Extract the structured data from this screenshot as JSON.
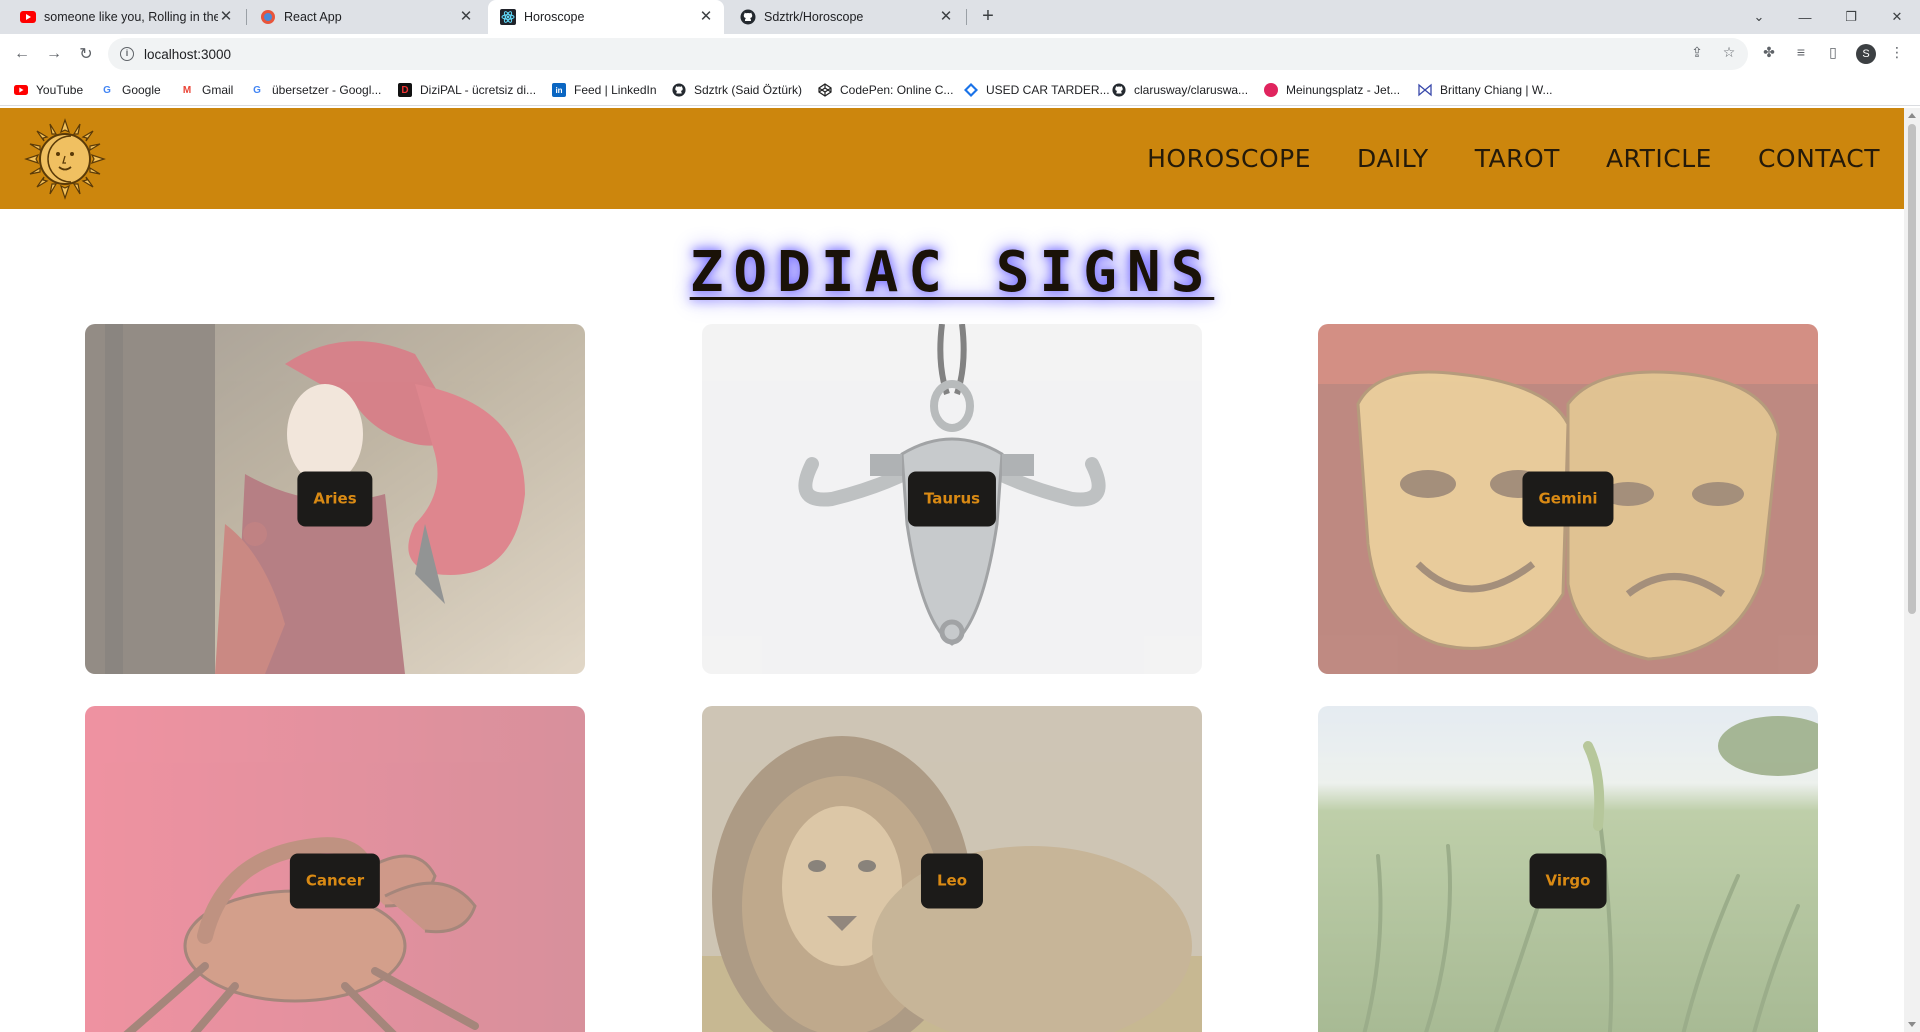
{
  "browser": {
    "tabs": [
      {
        "title": "someone like you, Rolling in the"
      },
      {
        "title": "React App"
      },
      {
        "title": "Horoscope"
      },
      {
        "title": "Sdztrk/Horoscope"
      }
    ],
    "url": "localhost:3000",
    "profile_initial": "S",
    "bookmarks": [
      "YouTube",
      "Google",
      "Gmail",
      "übersetzer - Googl...",
      "DiziPAL - ücretsiz di...",
      "Feed | LinkedIn",
      "Sdztrk (Said Öztürk)",
      "CodePen: Online C...",
      "USED CAR TARDER...",
      "clarusway/claruswa...",
      "Meinungsplatz - Jet...",
      "Brittany Chiang | W..."
    ]
  },
  "site": {
    "nav": [
      "HOROSCOPE",
      "DAILY",
      "TAROT",
      "ARTICLE",
      "CONTACT"
    ],
    "heading": "ZODIAC SIGNS",
    "signs": [
      "Aries",
      "Taurus",
      "Gemini",
      "Cancer",
      "Leo",
      "Virgo"
    ]
  },
  "colors": {
    "header_bg": "#cc860d",
    "label_bg": "#1c1b19",
    "label_text": "#d98a14",
    "heading_glow": "#6b62ff"
  }
}
